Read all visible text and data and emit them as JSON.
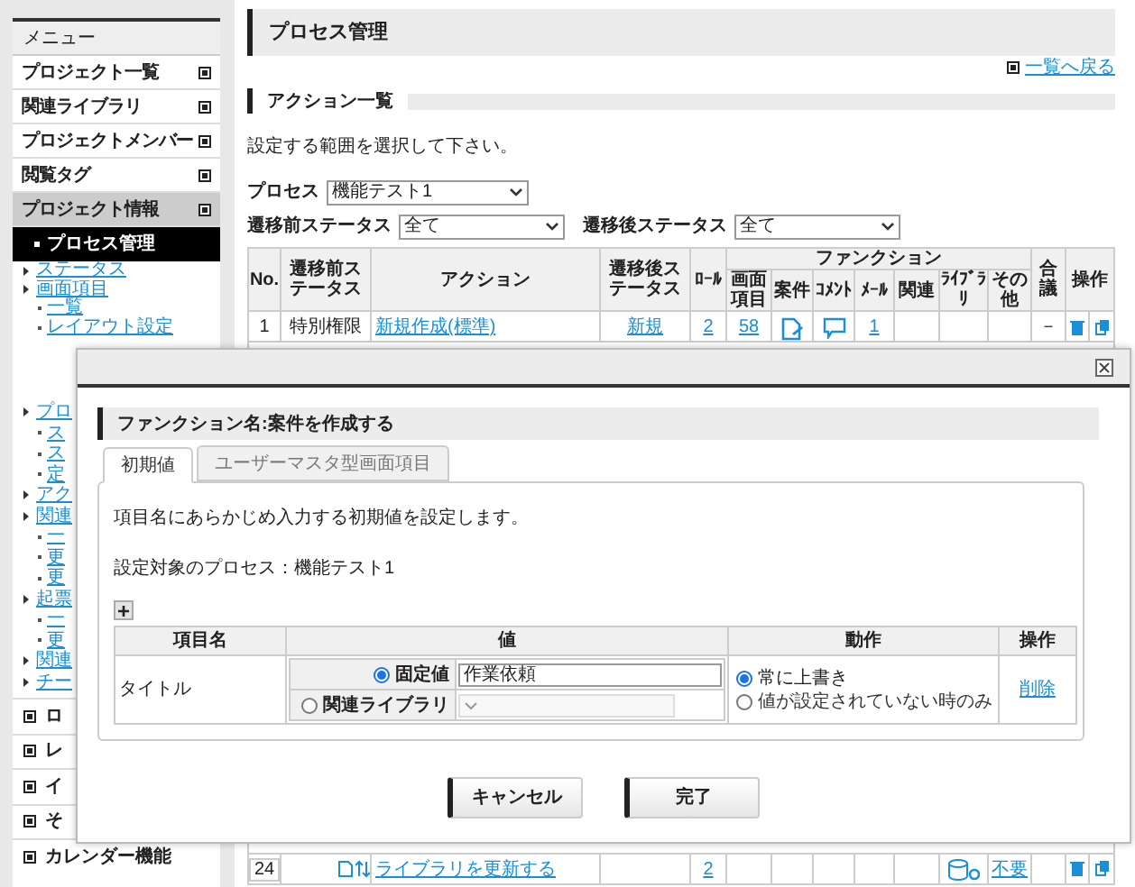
{
  "sidebar": {
    "header": "メニュー",
    "items": [
      {
        "label": "プロジェクト一覧",
        "selected": false
      },
      {
        "label": "関連ライブラリ",
        "selected": false
      },
      {
        "label": "プロジェクトメンバー",
        "selected": false
      },
      {
        "label": "閲覧タグ",
        "selected": false
      },
      {
        "label": "プロジェクト情報",
        "selected": true
      }
    ],
    "active_item": "プロセス管理",
    "links": [
      {
        "label": "ステータス"
      },
      {
        "label": "画面項目",
        "children": [
          {
            "label": "一覧"
          },
          {
            "label": "レイアウト設定"
          }
        ]
      },
      {
        "label": "プロ",
        "children": [
          {
            "label": "ス"
          },
          {
            "label": "ス"
          },
          {
            "label": "定"
          }
        ]
      },
      {
        "label": "アク"
      },
      {
        "label": "関連",
        "children": [
          {
            "label": "一"
          },
          {
            "label": "更"
          },
          {
            "label": "更"
          }
        ]
      },
      {
        "label": "起票",
        "children": [
          {
            "label": "一"
          },
          {
            "label": "更"
          }
        ]
      },
      {
        "label": "関連"
      },
      {
        "label": "チー"
      }
    ],
    "sections": [
      "ロ",
      "レ",
      "イ",
      "そ",
      "カレンダー機能"
    ]
  },
  "page": {
    "title": "プロセス管理",
    "back_link": "一覧へ戻る",
    "section_title": "アクション一覧",
    "instruction": "設定する範囲を選択して下さい。",
    "filters": [
      {
        "label": "プロセス",
        "value": "機能テスト1"
      },
      {
        "label": "遷移前ステータス",
        "value": "全て"
      },
      {
        "label": "遷移後ステータス",
        "value": "全て"
      }
    ]
  },
  "table": {
    "columns": [
      "No.",
      "遷移前ステータス",
      "アクション",
      "遷移後ステータス",
      "ﾛｰﾙ",
      "画面項目",
      "案件",
      "ｺﾒﾝﾄ",
      "ﾒｰﾙ",
      "関連",
      "ﾗｲﾌﾞﾗﾘ",
      "その他",
      "合議",
      "操作"
    ],
    "group_header": "ファンクション",
    "rows": [
      {
        "no": "1",
        "before": "特別権限",
        "action": "新規作成(標準)",
        "after": "新規",
        "role": "2",
        "screen": "58",
        "case_icon": true,
        "comment_icon": true,
        "mail": "1",
        "library_icon": false,
        "other": "",
        "consult": "－"
      },
      {
        "no": "24",
        "before": "",
        "action": "ライブラリを更新する",
        "after": "",
        "role": "2",
        "screen": "",
        "case_icon": false,
        "comment_icon": false,
        "mail": "",
        "library_icon": true,
        "other": "不要",
        "consult": ""
      }
    ]
  },
  "dialog": {
    "heading": "ファンクション名:案件を作成する",
    "tabs": [
      {
        "label": "初期値",
        "selected": true
      },
      {
        "label": "ユーザーマスタ型画面項目",
        "selected": false
      }
    ],
    "description": "項目名にあらかじめ入力する初期値を設定します。",
    "target": "設定対象のプロセス：機能テスト1",
    "add_button": "+",
    "columns": [
      "項目名",
      "値",
      "動作",
      "操作"
    ],
    "rows": [
      {
        "name": "タイトル",
        "sources": [
          {
            "label": "固定値",
            "selected": true,
            "kind": "text",
            "value": "作業依頼"
          },
          {
            "label": "関連ライブラリ",
            "selected": false,
            "kind": "select"
          }
        ],
        "modes": [
          {
            "label": "常に上書き",
            "selected": true
          },
          {
            "label": "値が設定されていない時のみ",
            "selected": false
          }
        ],
        "delete": "削除"
      }
    ],
    "buttons": [
      "キャンセル",
      "完了"
    ]
  }
}
